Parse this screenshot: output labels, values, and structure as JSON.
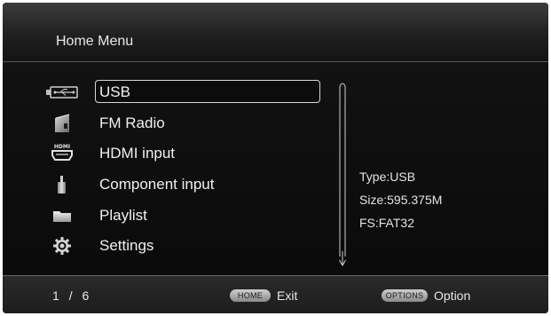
{
  "header": {
    "title": "Home Menu"
  },
  "menu": {
    "items": [
      {
        "label": "USB",
        "icon": "usb-icon",
        "selected": true
      },
      {
        "label": "FM Radio",
        "icon": "radio-icon",
        "selected": false
      },
      {
        "label": "HDMI input",
        "icon": "hdmi-icon",
        "selected": false
      },
      {
        "label": "Component input",
        "icon": "component-icon",
        "selected": false
      },
      {
        "label": "Playlist",
        "icon": "folder-icon",
        "selected": false
      },
      {
        "label": "Settings",
        "icon": "gear-icon",
        "selected": false
      }
    ]
  },
  "info": {
    "type": "Type:USB",
    "size": "Size:595.375M",
    "fs": "FS:FAT32"
  },
  "footer": {
    "page": "1",
    "separator": "/",
    "total": "6",
    "home_key": "HOME",
    "home_action": "Exit",
    "options_key": "OPTIONS",
    "options_action": "Option"
  }
}
